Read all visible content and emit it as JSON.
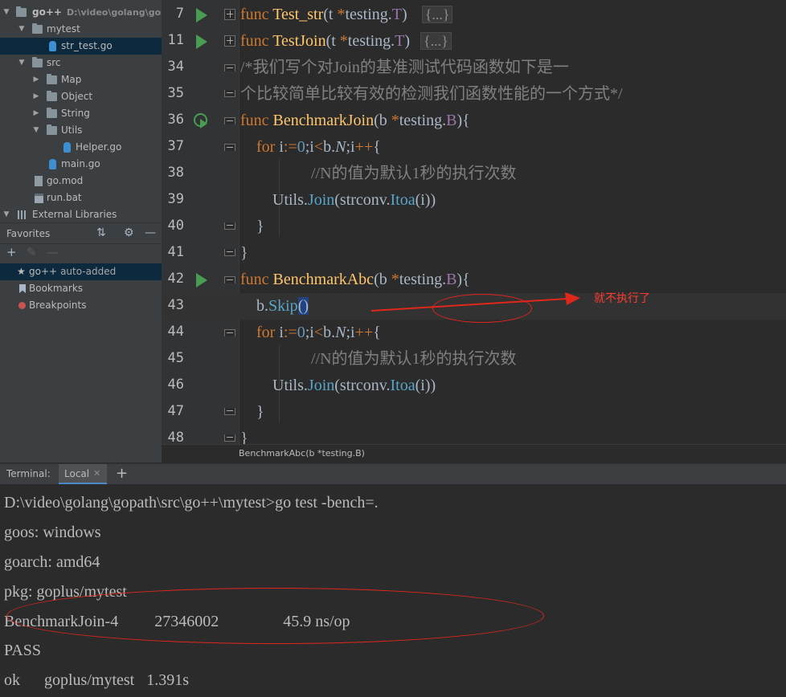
{
  "project": {
    "root_name": "go++",
    "root_path": "D:\\video\\golang\\gop",
    "items": [
      {
        "label": "mytest",
        "type": "folder"
      },
      {
        "label": "str_test.go",
        "type": "go"
      },
      {
        "label": "src",
        "type": "folder"
      },
      {
        "label": "Map",
        "type": "folder"
      },
      {
        "label": "Object",
        "type": "folder"
      },
      {
        "label": "String",
        "type": "folder"
      },
      {
        "label": "Utils",
        "type": "folder"
      },
      {
        "label": "Helper.go",
        "type": "go"
      },
      {
        "label": "main.go",
        "type": "go"
      },
      {
        "label": "go.mod",
        "type": "text"
      },
      {
        "label": "run.bat",
        "type": "bat"
      },
      {
        "label": "External Libraries",
        "type": "lib"
      }
    ]
  },
  "favorites": {
    "title": "Favorites",
    "items": [
      {
        "label": "go++",
        "suffix": "auto-added"
      },
      {
        "label": "Bookmarks",
        "suffix": ""
      },
      {
        "label": "Breakpoints",
        "suffix": ""
      }
    ]
  },
  "editor": {
    "line_numbers": [
      "7",
      "11",
      "34",
      "35",
      "36",
      "37",
      "38",
      "39",
      "40",
      "41",
      "42",
      "43",
      "44",
      "45",
      "46",
      "47",
      "48"
    ],
    "folded_placeholder": "{...}",
    "comment_line_1": "/*我们写个对Join的基准测试代码函数如下是一",
    "comment_line_2": "个比较简单比较有效的检测我们函数性能的一个方式*/",
    "inner_comment": "//N的值为默认1秒的执行次数",
    "breadcrumb": "BenchmarkAbc(b *testing.B)"
  },
  "annotation": {
    "text": "就不执行了"
  },
  "terminal": {
    "label": "Terminal:",
    "tab": "Local",
    "lines": [
      "D:\\video\\golang\\gopath\\src\\go++\\mytest>go test -bench=.",
      "goos: windows",
      "goarch: amd64",
      "pkg: goplus/mytest",
      "BenchmarkJoin-4         27346002                45.9 ns/op",
      "PASS",
      "ok      goplus/mytest   1.391s"
    ]
  },
  "colors": {
    "keyword": "#cc7832",
    "function": "#ffc66d",
    "comment": "#808080",
    "run_icon": "#499c54",
    "annotation": "#e0271a",
    "selection": "#0d293e"
  }
}
